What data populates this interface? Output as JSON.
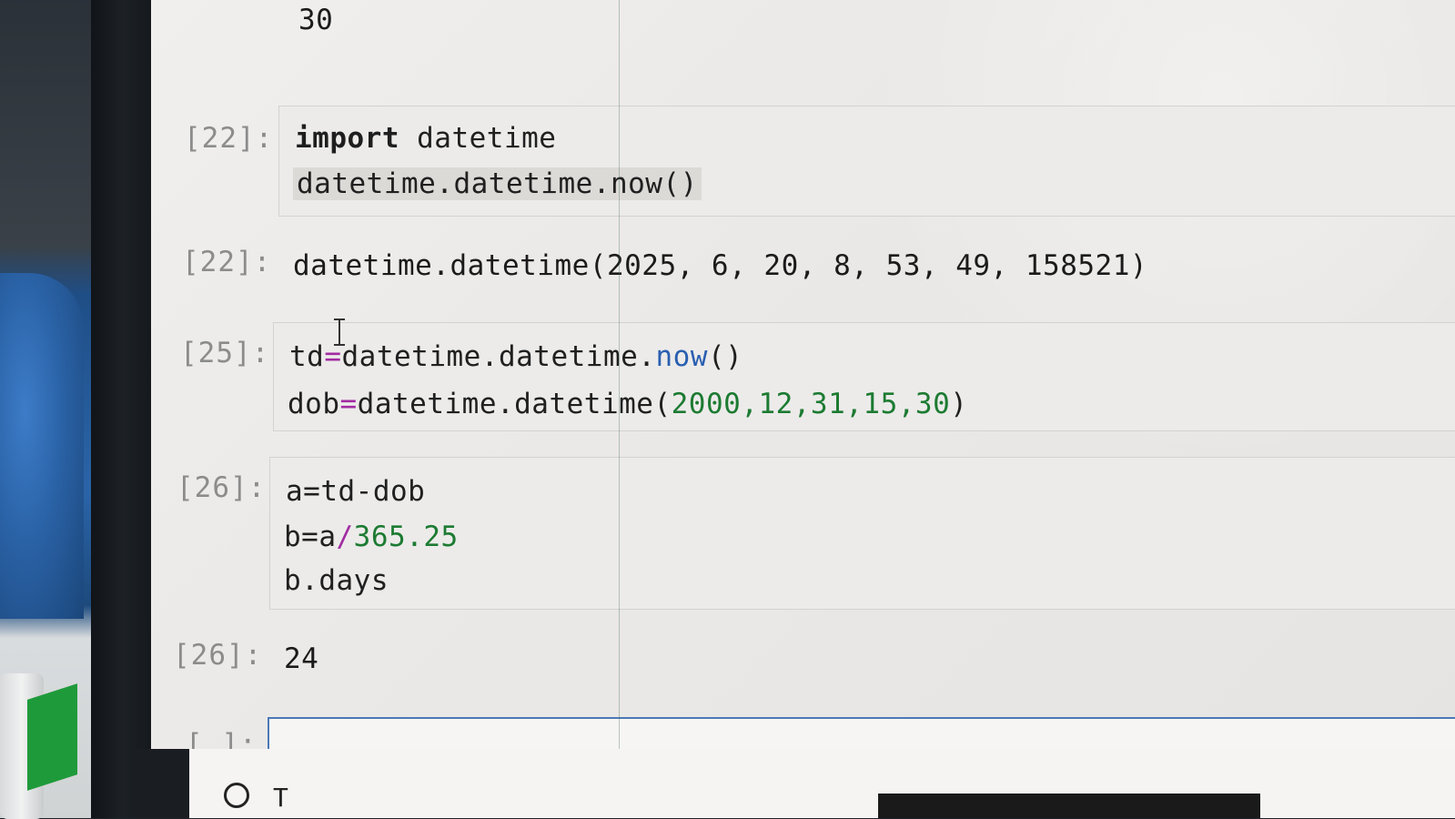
{
  "notebook": {
    "top_output": "30",
    "cells": [
      {
        "prompt": "[22]:",
        "type": "input",
        "lines": {
          "l1_kw": "import",
          "l1_rest": " datetime",
          "l2": "datetime.datetime.now()"
        }
      },
      {
        "prompt": "[22]:",
        "type": "output",
        "text_head": "datetime.datetime(",
        "text_args": "2025, 6, 20, 8, 53, 49, 158521",
        "text_tail": ")"
      },
      {
        "prompt": "[25]:",
        "type": "input",
        "lines": {
          "l1_a": "td",
          "l1_op": "=",
          "l1_b": "datetime.datetime.",
          "l1_m": "now",
          "l1_c": "()",
          "l2_a": "dob",
          "l2_op": "=",
          "l2_b": "datetime.datetime(",
          "l2_nums": "2000,12,31,15,30",
          "l2_c": ")"
        }
      },
      {
        "prompt": "[26]:",
        "type": "input",
        "lines": {
          "l1": "a=td-dob",
          "l2_a": "b=a",
          "l2_op": "/",
          "l2_num": "365.25",
          "l3": "b.days"
        }
      },
      {
        "prompt": "[26]:",
        "type": "output",
        "text": "24"
      },
      {
        "prompt": "[ ]:",
        "type": "active-input",
        "text": ""
      }
    ]
  },
  "colors": {
    "keyword": "#1e1e1e",
    "operator": "#a22ba2",
    "number": "#1d7b32",
    "method": "#2a5fb0",
    "prompt": "#8c8c8c",
    "active_border": "#4a78b6"
  },
  "bottom_bar": {
    "icon": "circle-icon",
    "glyph": "T"
  }
}
